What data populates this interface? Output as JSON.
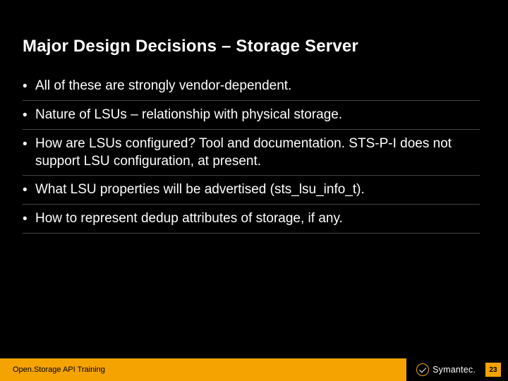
{
  "title": "Major Design Decisions – Storage Server",
  "bullets": [
    "All of these are strongly vendor-dependent.",
    "Nature of LSUs – relationship with physical storage.",
    "How are LSUs configured? Tool and documentation. STS-P-I does not support LSU configuration, at present.",
    "What LSU properties will be advertised (sts_lsu_info_t).",
    "How to represent dedup attributes of storage, if any."
  ],
  "footer": {
    "left_label": "Open.Storage API Training",
    "brand": "Symantec.",
    "page_number": "23"
  }
}
